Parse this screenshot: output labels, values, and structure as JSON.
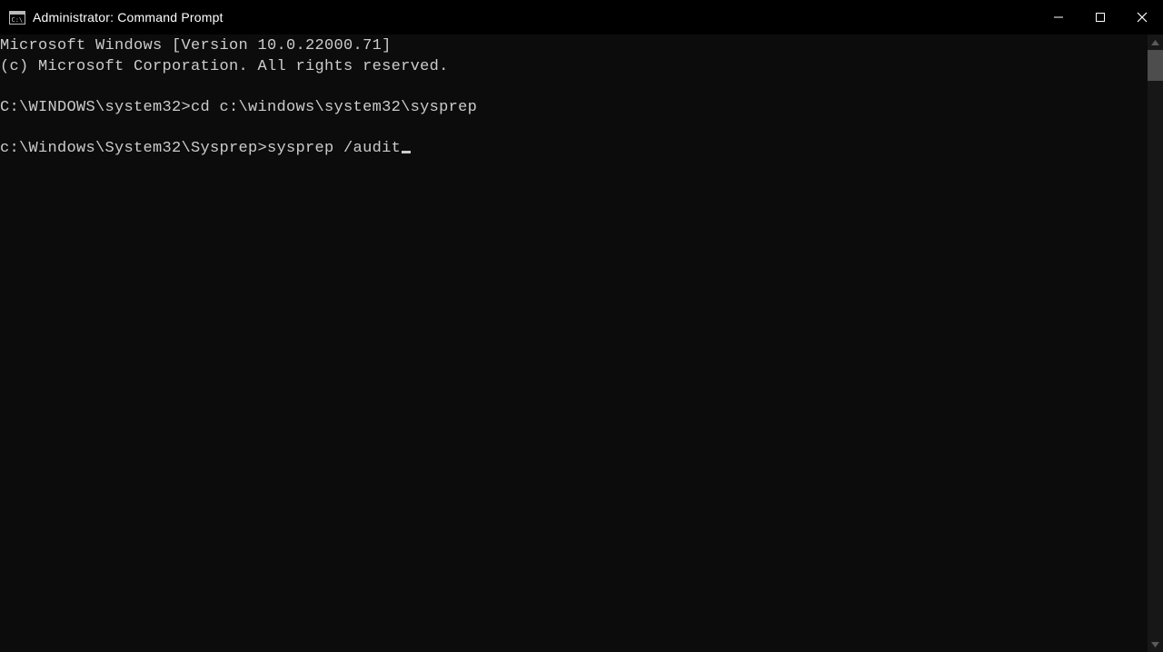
{
  "window": {
    "title": "Administrator: Command Prompt",
    "icon_name": "cmd-icon"
  },
  "terminal": {
    "lines": [
      "Microsoft Windows [Version 10.0.22000.71]",
      "(c) Microsoft Corporation. All rights reserved.",
      "",
      "C:\\WINDOWS\\system32>cd c:\\windows\\system32\\sysprep",
      ""
    ],
    "current_prompt": "c:\\Windows\\System32\\Sysprep>",
    "current_input": "sysprep /audit"
  }
}
